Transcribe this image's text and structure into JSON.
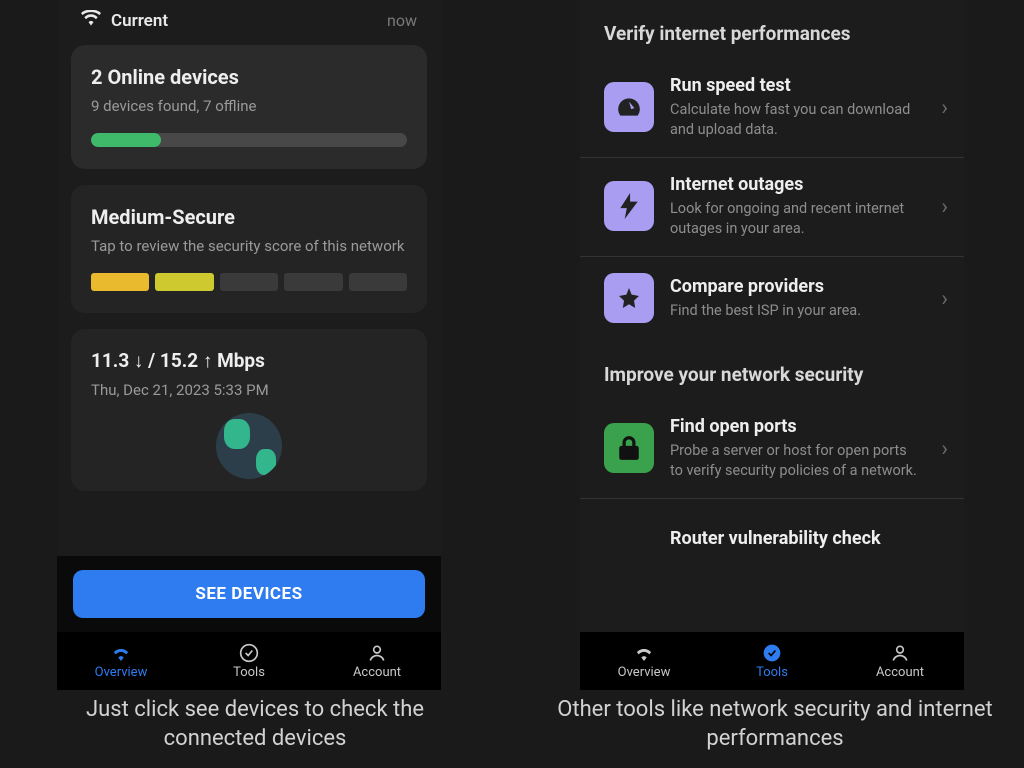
{
  "left": {
    "status": {
      "name": "Current",
      "time": "now"
    },
    "devices": {
      "title": "2 Online devices",
      "sub": "9 devices found, 7 offline",
      "progress_pct": 22
    },
    "security": {
      "title": "Medium-Secure",
      "sub": "Tap to review the security score of this network",
      "bars_filled": 2
    },
    "speed": {
      "line": "11.3 ↓ / 15.2 ↑ Mbps",
      "date": "Thu, Dec 21, 2023 5:33 PM"
    },
    "cta": "SEE DEVICES",
    "nav": {
      "overview": "Overview",
      "tools": "Tools",
      "account": "Account",
      "active": "overview"
    }
  },
  "right": {
    "section1": "Verify internet performances",
    "tools1": [
      {
        "icon": "gauge",
        "title": "Run speed test",
        "sub": "Calculate how fast you can download and upload data."
      },
      {
        "icon": "bolt",
        "title": "Internet outages",
        "sub": "Look for ongoing and recent internet outages in your area."
      },
      {
        "icon": "star",
        "title": "Compare providers",
        "sub": "Find the best ISP in your area."
      }
    ],
    "section2": "Improve your network security",
    "tools2": [
      {
        "icon": "lock",
        "title": "Find open ports",
        "sub": "Probe a server or host for open ports to verify security policies of a network."
      },
      {
        "icon": "router",
        "title": "Router vulnerability check",
        "sub": ""
      }
    ],
    "nav": {
      "overview": "Overview",
      "tools": "Tools",
      "account": "Account",
      "active": "tools"
    }
  },
  "captions": {
    "left": "Just click see devices to check the connected devices",
    "right": "Other tools like network security and internet performances"
  }
}
